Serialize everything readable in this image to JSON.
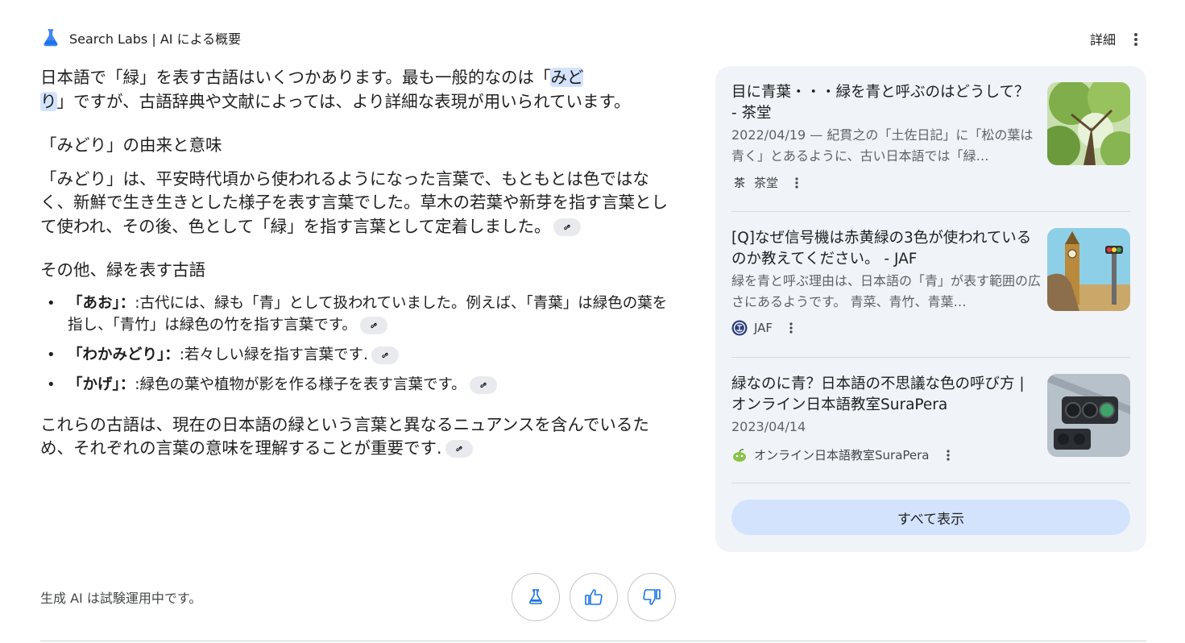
{
  "header": {
    "title": "Search Labs | AI による概要",
    "details_label": "詳細"
  },
  "main": {
    "intro_a": "日本語で「緑」を表す古語はいくつかあります。最も一般的なのは「",
    "intro_highlight_1": "みど",
    "intro_highlight_2": "り",
    "intro_b": "」ですが、古語辞典や文献によっては、より詳細な表現が用いられています。",
    "section1_heading": "「みどり」の由来と意味",
    "section1_body": "「みどり」は、平安時代頃から使われるようになった言葉で、もともとは色ではなく、新鮮で生き生きとした様子を表す言葉でした。草木の若葉や新芽を指す言葉として使われ、その後、色として「緑」を指す言葉として定着しました。",
    "section2_heading": "その他、緑を表す古語",
    "terms": [
      {
        "term": "「あお」：",
        "desc": ":古代には、緑も「青」として扱われていました。例えば、「青葉」は緑色の葉を指し、「青竹」は緑色の竹を指す言葉です。"
      },
      {
        "term": "「わかみどり」：",
        "desc": ":若々しい緑を指す言葉です."
      },
      {
        "term": "「かげ」：",
        "desc": ":緑色の葉や植物が影を作る様子を表す言葉です。"
      }
    ],
    "conclusion": "これらの古語は、現在の日本語の緑という言葉と異なるニュアンスを含んでいるため、それぞれの言葉の意味を理解することが重要です."
  },
  "footer": {
    "note": "生成 AI は試験運用中です。"
  },
  "sources": [
    {
      "title": "目に青葉・・・緑を青と呼ぶのはどうして？ - 茶堂",
      "snippet": "2022/04/19 — 紀貫之の「土佐日記」に「松の葉は青く」とあるように、古い日本語では「緑…",
      "favicon_char": "茶",
      "site": "茶堂"
    },
    {
      "title": "[Q]なぜ信号機は赤黄緑の3色が使われているのか教えてください。 - JAF",
      "snippet": "緑を青と呼ぶ理由は、日本語の「青」が表す範囲の広さにあるようです。 青菜、青竹、青葉…",
      "favicon_char": "",
      "site": "JAF"
    },
    {
      "title": "緑なのに青？日本語の不思議な色の呼び方 | オンライン日本語教室SuraPera",
      "snippet": "2023/04/14",
      "favicon_char": "",
      "site": "オンライン日本語教室SuraPera"
    }
  ],
  "show_all_label": "すべて表示",
  "colors": {
    "accent": "#1a73e8",
    "panel_bg": "#f0f4f9",
    "highlight": "#d3e3fd",
    "show_all_bg": "#d3e3fd"
  }
}
